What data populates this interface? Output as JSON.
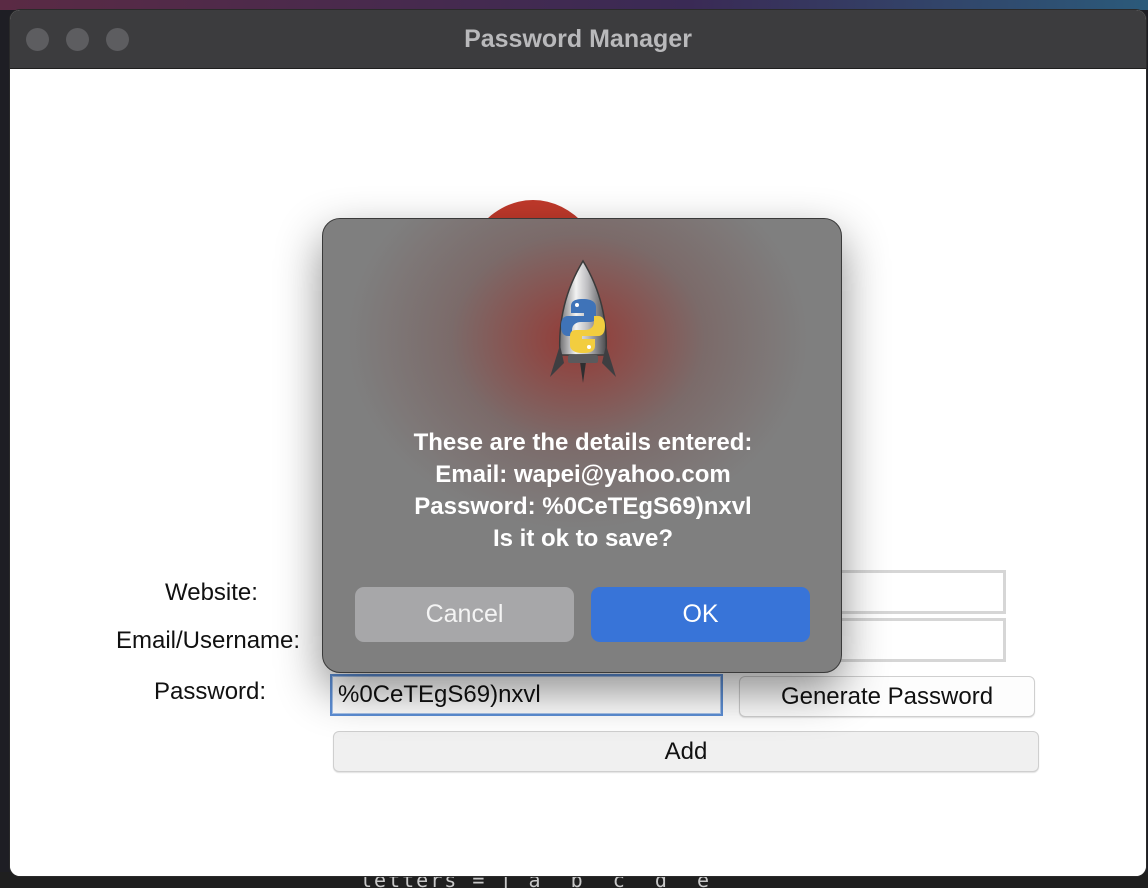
{
  "window": {
    "title": "Password Manager"
  },
  "form": {
    "website_label": "Website:",
    "email_label": "Email/Username:",
    "password_label": "Password:",
    "website_value": "",
    "email_value": "",
    "password_value": "%0CeTEgS69)nxvl",
    "generate_label": "Generate Password",
    "add_label": "Add"
  },
  "dialog": {
    "icon": "python-rocket-icon",
    "message_lines": [
      "These are the details entered:",
      "Email: wapei@yahoo.com",
      "Password: %0CeTEgS69)nxvl",
      "Is it ok to save?"
    ],
    "cancel_label": "Cancel",
    "ok_label": "OK"
  },
  "background_code": {
    "text": "letters = [ a  b  c  d  e"
  },
  "colors": {
    "accent": "#3874d8",
    "logo_red": "#c0392b",
    "titlebar": "#3c3c3e"
  }
}
